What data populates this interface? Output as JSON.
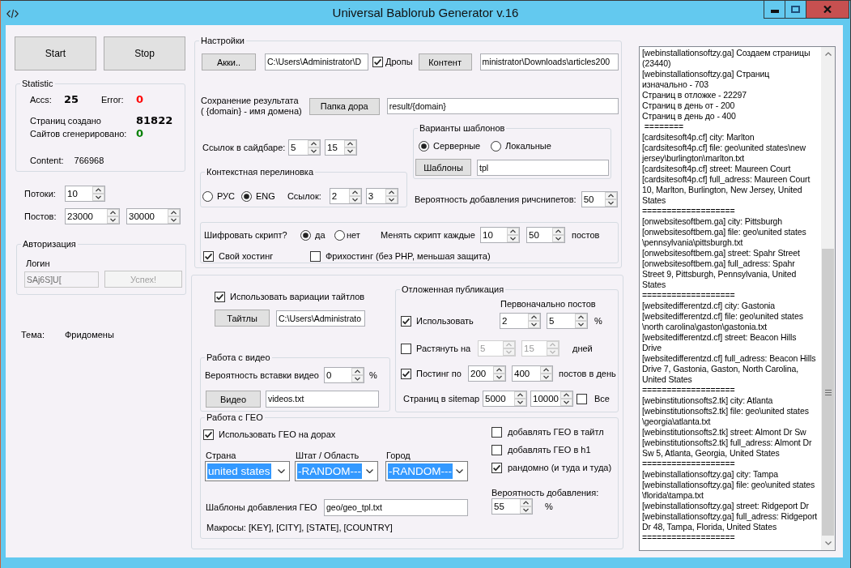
{
  "window": {
    "title": "Universal Bablorub Generator v.16"
  },
  "actions": [
    {
      "label": "Start"
    },
    {
      "label": "Stop"
    }
  ],
  "statistic": {
    "title": "Statistic",
    "rows": [
      {
        "cells": [
          {
            "label": "Accs:",
            "value": "25",
            "color": "#000000"
          },
          {
            "label": "Error:",
            "value": "0",
            "color": "#ff0000"
          }
        ]
      },
      {
        "cells": [
          {
            "label": "Страниц создано",
            "value": "81822",
            "color": "#000000"
          }
        ]
      },
      {
        "cells": [
          {
            "label": "Сайтов сгенерировано:",
            "value": "0",
            "color": "#008000"
          }
        ]
      }
    ],
    "content": {
      "label": "Content:",
      "value": "766968"
    }
  },
  "limits": [
    {
      "label": "Потоки:",
      "spins": [
        "10"
      ]
    },
    {
      "label": "Постов:",
      "spins": [
        "23000",
        "30000"
      ]
    }
  ],
  "auth": {
    "title": "Авторизация",
    "login_label": "Логин",
    "login": {
      "value": "SAj6S]U[",
      "disabled": true
    },
    "button": {
      "label": "Успех!",
      "disabled": true
    }
  },
  "theme": {
    "label": "Тема:",
    "value": "Фридомены"
  },
  "settings": {
    "title": "Настройки",
    "accounts": {
      "button": "Акки..",
      "path": "C:\\Users\\Administrator\\D"
    },
    "drops": {
      "label": "Дропы",
      "checked": true
    },
    "content": {
      "button": "Контент",
      "path": "ministrator\\Downloads\\articles200"
    },
    "result": {
      "label": "Сохранение результата\n( {domain} - имя домена)",
      "button": "Папка дора",
      "path": "result/{domain}"
    },
    "sidebar_links": {
      "label": "Ссылок в сайдбаре:",
      "spins": [
        "5",
        "15"
      ]
    },
    "context_linking": {
      "title": "Контекстная перелиновка",
      "options": [
        {
          "label": "РУС",
          "selected": false
        },
        {
          "label": "ENG",
          "selected": true
        }
      ],
      "links_label": "Ссылок:",
      "spins": [
        "2",
        "3"
      ]
    },
    "templates": {
      "title": "Варианты шаблонов",
      "options": [
        {
          "label": "Серверные",
          "selected": true
        },
        {
          "label": "Локальные",
          "selected": false
        }
      ],
      "button": "Шаблоны",
      "path": "tpl"
    },
    "richsnippets": {
      "label": "Вероятность добавления ричснипетов:",
      "spins": [
        "50"
      ]
    },
    "script": {
      "encrypt_label": "Шифровать скрипт?",
      "options": [
        {
          "label": "да",
          "selected": true
        },
        {
          "label": "нет",
          "selected": false
        }
      ],
      "change_label": "Менять скрипт каждые",
      "spins": [
        "10",
        "50"
      ],
      "unit": "постов",
      "hosting": [
        {
          "label": "Свой хостинг",
          "checked": true
        },
        {
          "label": "Фрихостинг (без PHP, меньшая защита)",
          "checked": false
        }
      ]
    }
  },
  "titles": {
    "use": {
      "label": "Использовать вариации тайтлов",
      "checked": true
    },
    "button": "Тайтлы",
    "path": "C:\\Users\\Administrato"
  },
  "video": {
    "title": "Работа с видео",
    "chance_label": "Вероятность вставки видео",
    "spins": [
      "0"
    ],
    "unit": "%",
    "button": "Видео",
    "path": "videos.txt"
  },
  "deferred": {
    "title": "Отложенная публикация",
    "initial_label": "Первоначально постов",
    "rows": [
      {
        "kind": "check",
        "label": "Использовать",
        "checked": true,
        "spins": [
          {
            "value": "2",
            "disabled": false
          },
          {
            "value": "5",
            "disabled": false
          }
        ],
        "unit": "%"
      },
      {
        "kind": "check",
        "label": "Растянуть на",
        "checked": false,
        "spins": [
          {
            "value": "5",
            "disabled": true
          },
          {
            "value": "15",
            "disabled": true
          }
        ],
        "unit": "дней"
      },
      {
        "kind": "check",
        "label": "Постинг по",
        "checked": true,
        "spins": [
          {
            "value": "200",
            "disabled": false
          },
          {
            "value": "400",
            "disabled": false
          }
        ],
        "unit": "постов в день"
      },
      {
        "kind": "sitemap",
        "label": "Страниц в sitemap",
        "spins": [
          {
            "value": "5000",
            "disabled": false
          },
          {
            "value": "10000",
            "disabled": false
          }
        ],
        "all": {
          "label": "Все",
          "checked": false
        }
      }
    ]
  },
  "geo": {
    "title": "Работа с ГЕО",
    "use": {
      "label": "Использовать ГЕО на дорах",
      "checked": true
    },
    "selects": [
      {
        "label": "Страна",
        "value": "united states"
      },
      {
        "label": "Штат / Область",
        "value": "-RANDOM---"
      },
      {
        "label": "Город",
        "value": "-RANDOM---"
      }
    ],
    "template": {
      "label": "Шаблоны добавления ГЕО",
      "path": "geo/geo_tpl.txt"
    },
    "macros": "Макросы: [KEY], [CITY], [STATE], [COUNTRY]",
    "options": [
      {
        "label": "добавлять ГЕО в тайтл",
        "checked": false
      },
      {
        "label": "добавлять ГЕО в h1",
        "checked": false
      },
      {
        "label": "рандомно (и туда и туда)",
        "checked": true
      }
    ],
    "chance_label": "Вероятность добавления:",
    "spins": [
      "55"
    ],
    "unit": "%"
  },
  "log": {
    "lines": [
      "[webinstallationsoftzy.ga] Создаем страницы",
      "(23440)",
      "[webinstallationsoftzy.ga] Страниц",
      "изначально - 703",
      "Страниц в отложке - 22297",
      "Страниц в день от - 200",
      "Страниц в день до - 400",
      " ========",
      "[cardsitesoft4p.cf] city: Marlton",
      "[cardsitesoft4p.cf] file: geo\\united states\\new",
      "jersey\\burlington\\marlton.txt",
      "[cardsitesoft4p.cf] street: Maureen Court",
      "[cardsitesoft4p.cf] full_adress: Maureen Court",
      "10, Marlton, Burlington, New Jersey, United",
      "States",
      "===================",
      "[onwebsitesoftbem.ga] city: Pittsburgh",
      "[onwebsitesoftbem.ga] file: geo\\united states",
      "\\pennsylvania\\pittsburgh.txt",
      "[onwebsitesoftbem.ga] street: Spahr Street",
      "[onwebsitesoftbem.ga] full_adress: Spahr",
      "Street 9, Pittsburgh, Pennsylvania, United",
      "States",
      "===================",
      "[websitedifferentzd.cf] city: Gastonia",
      "[websitedifferentzd.cf] file: geo\\united states",
      "\\north carolina\\gaston\\gastonia.txt",
      "[websitedifferentzd.cf] street: Beacon Hills",
      "Drive",
      "[websitedifferentzd.cf] full_adress: Beacon Hills",
      "Drive 7, Gastonia, Gaston, North Carolina,",
      "United States",
      "===================",
      "[webinstitutionsofts2.tk] city: Atlanta",
      "[webinstitutionsofts2.tk] file: geo\\united states",
      "\\georgia\\atlanta.txt",
      "[webinstitutionsofts2.tk] street: Almont Dr Sw",
      "[webinstitutionsofts2.tk] full_adress: Almont Dr",
      "Sw 5, Atlanta, Georgia, United States",
      "===================",
      "[webinstallationsoftzy.ga] city: Tampa",
      "[webinstallationsoftzy.ga] file: geo\\united states",
      "\\florida\\tampa.txt",
      "[webinstallationsoftzy.ga] street: Ridgeport Dr",
      "[webinstallationsoftzy.ga] full_adress: Ridgeport",
      "Dr 48, Tampa, Florida, United States",
      "==================="
    ]
  }
}
